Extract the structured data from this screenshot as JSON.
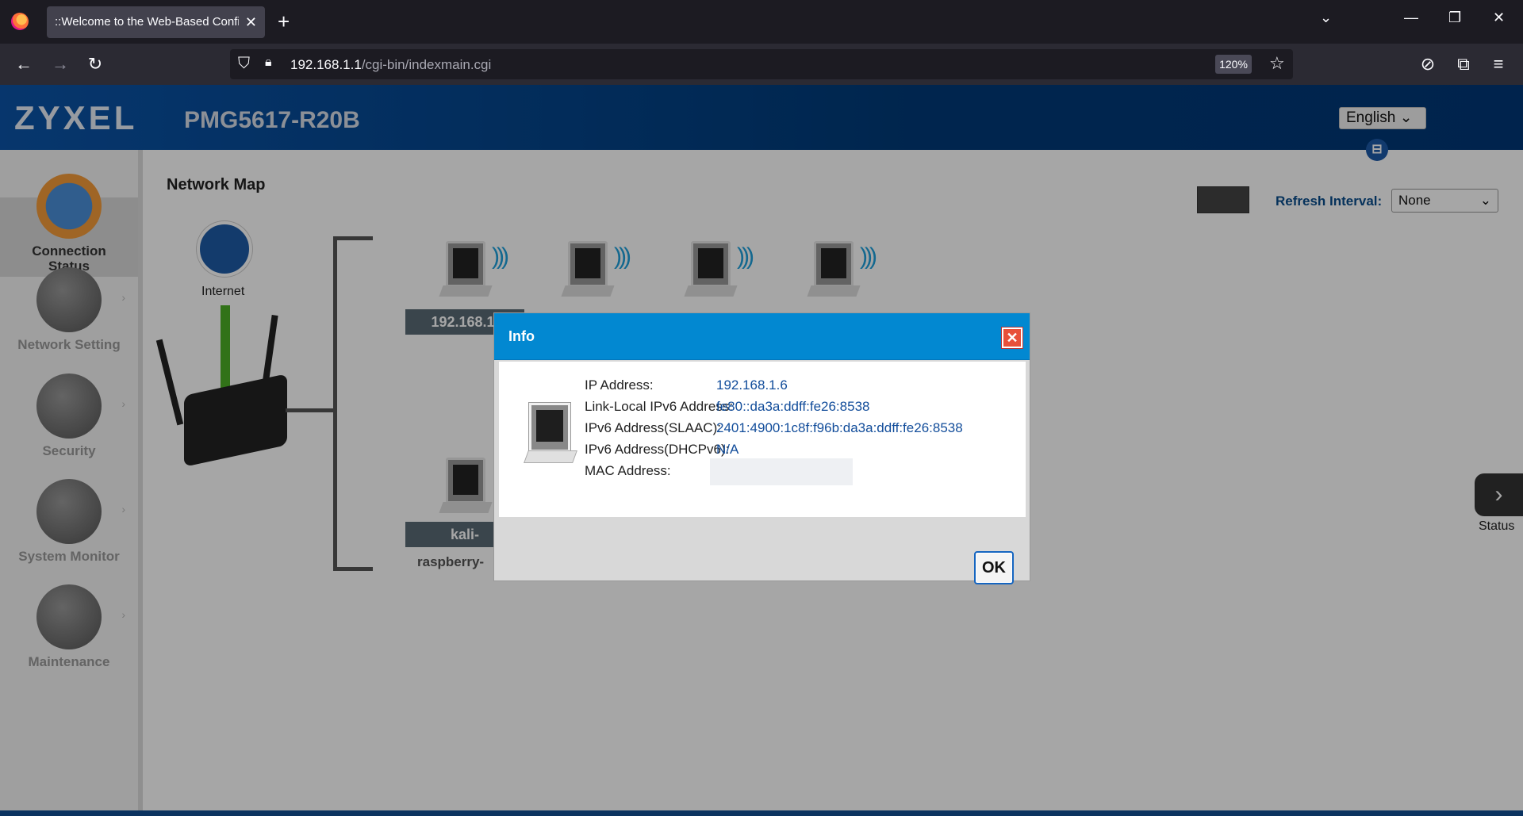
{
  "browser": {
    "tab_title": "::Welcome to the Web-Based Confi",
    "tab_close": "✕",
    "new_tab": "+",
    "url_host": "192.168.1.1",
    "url_path": "/cgi-bin/indexmain.cgi",
    "zoom": "120%",
    "back": "←",
    "forward": "→",
    "reload": "↻",
    "list_all_tabs": "⌄",
    "minimize": "—",
    "restore": "❐",
    "close": "✕",
    "shield": "⛉",
    "lock": "🔒︎",
    "bookmark": "☆",
    "pocket": "⊘",
    "extensions": "⧉",
    "menu": "≡"
  },
  "router": {
    "brand": "ZYXEL",
    "model": "PMG5617-R20B",
    "language": "English ⌄",
    "logout_glyph": "⊟",
    "page_title": "Network Map",
    "refresh_label": "Refresh Interval:",
    "refresh_value": "None",
    "internet_label": "Internet",
    "status_label": "Status",
    "status_arrow": "›",
    "sidebar": [
      {
        "label": "Connection\nStatus"
      },
      {
        "label": "Network Setting"
      },
      {
        "label": "Security"
      },
      {
        "label": "System Monitor"
      },
      {
        "label": "Maintenance"
      }
    ],
    "devices": {
      "first_label": "192.168.1.",
      "lower_label": "kali-",
      "lower_sub": "raspberry-"
    }
  },
  "dialog": {
    "title": "Info",
    "close": "✕",
    "ok": "OK",
    "rows": [
      {
        "label": "IP Address:",
        "value": "192.168.1.6"
      },
      {
        "label": "Link-Local IPv6 Address:",
        "value": "fe80::da3a:ddff:fe26:8538"
      },
      {
        "label": "IPv6 Address(SLAAC):",
        "value": "2401:4900:1c8f:f96b:da3a:ddff:fe26:8538"
      },
      {
        "label": "IPv6 Address(DHCPv6):",
        "value": "N/A"
      },
      {
        "label": "MAC Address:",
        "value": ""
      }
    ]
  },
  "colors": {
    "dialog_header": "#0288d1",
    "router_header": "#003a78",
    "value_text": "#114c9a"
  }
}
